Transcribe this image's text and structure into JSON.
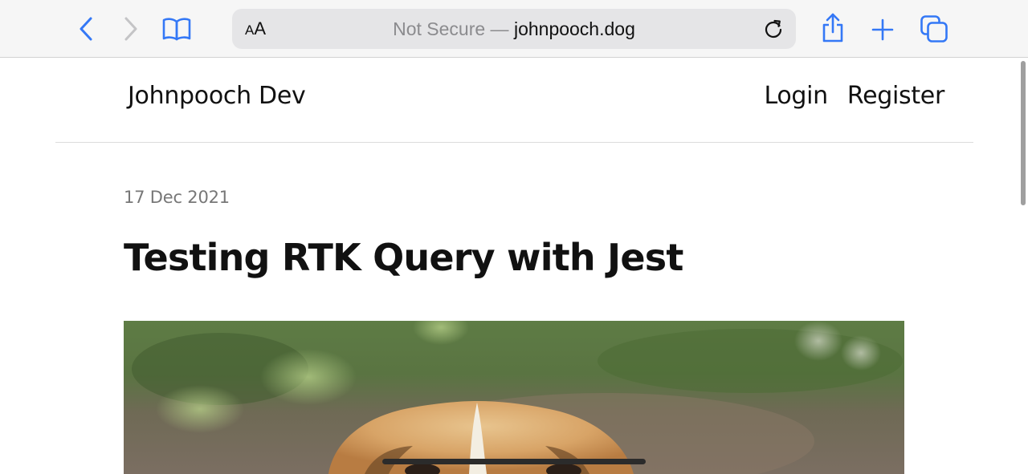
{
  "browser": {
    "text_size_button": {
      "small": "A",
      "big": "A"
    },
    "address": {
      "prefix": "Not Secure — ",
      "host": "johnpooch.dog"
    },
    "icons": {
      "back": "chevron-left-icon",
      "forward": "chevron-right-icon",
      "bookmarks": "book-icon",
      "reload": "reload-icon",
      "share": "share-icon",
      "new_tab": "plus-icon",
      "tabs": "tabs-icon"
    },
    "accent_color": "#3478f6"
  },
  "site": {
    "brand": "Johnpooch Dev",
    "nav": {
      "login": "Login",
      "register": "Register"
    }
  },
  "post": {
    "date": "17 Dec 2021",
    "title": "Testing RTK Query with Jest",
    "hero_image": "puppy-photo"
  }
}
